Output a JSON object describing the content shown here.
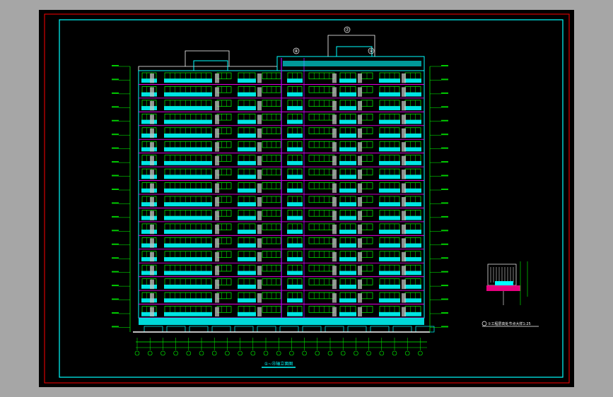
{
  "drawing": {
    "main_title": "①~㉓轴立面图",
    "detail_title": "①工程层高处节点大样1:25",
    "axis_tags": [
      "⑦",
      "⑧",
      "⑨"
    ],
    "total_floors": 18,
    "colors": {
      "background": "#000000",
      "frame_outer": "#ff0000",
      "frame_inner": "#00ffff",
      "facade_wall": "#00ffff",
      "window": "#00ff00",
      "balcony": "#00e5e5",
      "column": "#c0c0c0",
      "floor_line": "#ff00ff",
      "dimension": "#00ff00",
      "roof_line": "#ffffff"
    }
  }
}
